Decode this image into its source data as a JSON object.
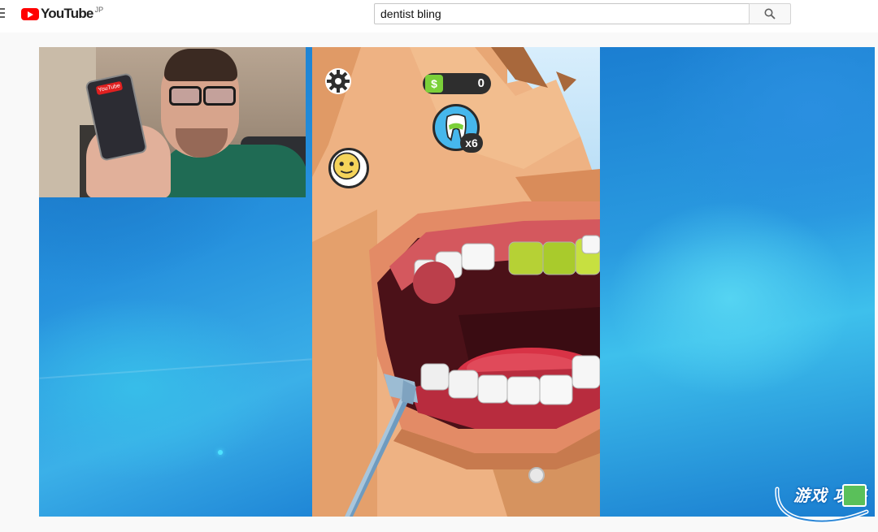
{
  "header": {
    "logo_text": "YouTube",
    "region": "JP",
    "search": {
      "value": "dentist bling",
      "placeholder": "Search"
    }
  },
  "player": {
    "game_hud": {
      "money_symbol": "$",
      "money_value": "0",
      "tooth_count": "x6"
    },
    "webcam_phone_logo": "YouTube"
  },
  "watermark": {
    "text": "游戏 攻略"
  },
  "colors": {
    "brand_red": "#ff0000",
    "money_green": "#7bd039",
    "tooth_badge_blue": "#46b7ec",
    "background_blue": "#2691dd"
  },
  "icons": {
    "menu": "hamburger-menu-icon",
    "search": "search-icon",
    "settings": "gear-icon",
    "tooth": "tooth-icon",
    "mood": "smiley-face-icon"
  }
}
